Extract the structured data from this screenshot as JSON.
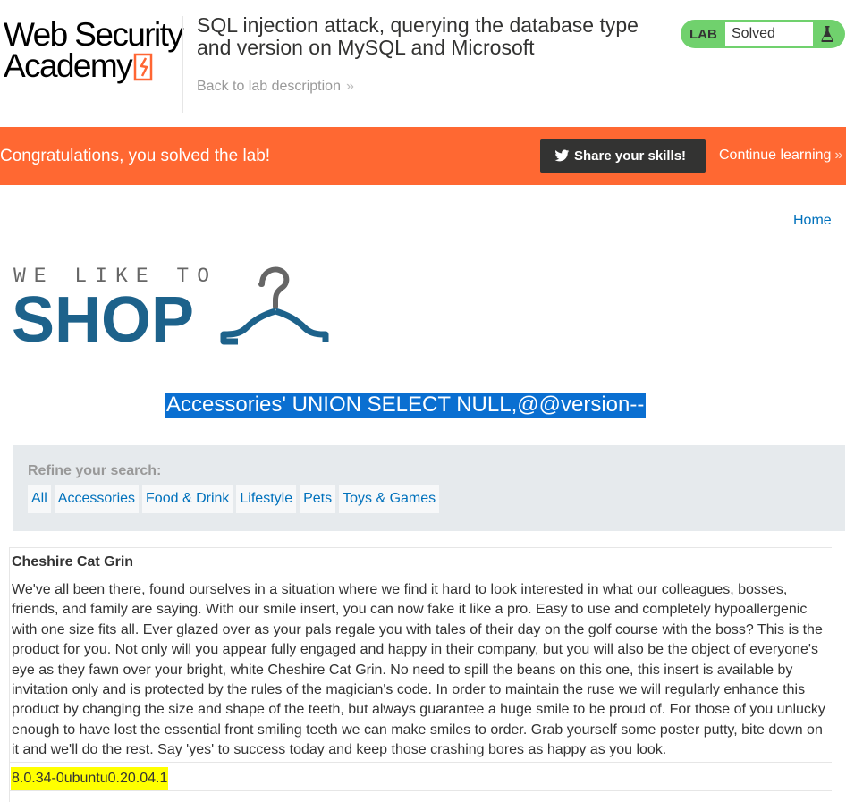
{
  "academy": {
    "logo_line1": "Web Security",
    "logo_line2": "Academy"
  },
  "lab": {
    "title": "SQL injection attack, querying the database type and version on MySQL and Microsoft",
    "back_link": "Back to lab description",
    "back_chevron": "»",
    "status_label": "LAB",
    "status_value": "Solved"
  },
  "banner": {
    "message": "Congratulations, you solved the lab!",
    "share_label": "Share your skills!",
    "continue_label": "Continue learning",
    "continue_chevron": "»"
  },
  "shop": {
    "home_link": "Home",
    "tagline": "WE LIKE TO",
    "name": "SHOP",
    "search_heading": "Accessories' UNION SELECT NULL,@@version--",
    "refine_label": "Refine your search:",
    "filters": [
      {
        "label": "All"
      },
      {
        "label": "Accessories"
      },
      {
        "label": "Food & Drink"
      },
      {
        "label": "Lifestyle"
      },
      {
        "label": "Pets"
      },
      {
        "label": "Toys & Games"
      }
    ]
  },
  "results": [
    {
      "name": "Cheshire Cat Grin",
      "description": "We've all been there, found ourselves in a situation where we find it hard to look interested in what our colleagues, bosses, friends, and family are saying. With our smile insert, you can now fake it like a pro. Easy to use and completely hypoallergenic with one size fits all. Ever glazed over as your pals regale you with tales of their day on the golf course with the boss? This is the product for you. Not only will you appear fully engaged and happy in their company, but you will also be the object of everyone's eye as they fawn over your bright, white Cheshire Cat Grin. No need to spill the beans on this one, this insert is available by invitation only and is protected by the rules of the magician's code. In order to maintain the ruse we will regularly enhance this product by changing the size and shape of the teeth, but always guarantee a huge smile to be proud of. For those of you unlucky enough to have lost the essential front smiling teeth we can make smiles to order. Grab yourself some poster putty, bite down on it and we'll do the rest. Say 'yes' to success today and keep those crashing bores as happy as you look.",
      "version": "8.0.34-0ubuntu0.20.04.1"
    }
  ],
  "colors": {
    "brand_orange": "#ff6832",
    "lab_solved_green": "#70d16d",
    "link_blue": "#0071bc",
    "shop_blue": "#1d628b",
    "selection_blue": "#0a6fd1",
    "highlight_yellow": "#ffff00"
  },
  "icons": {
    "status": "flask-icon",
    "share": "twitter-icon",
    "shop": "hanger-icon"
  }
}
